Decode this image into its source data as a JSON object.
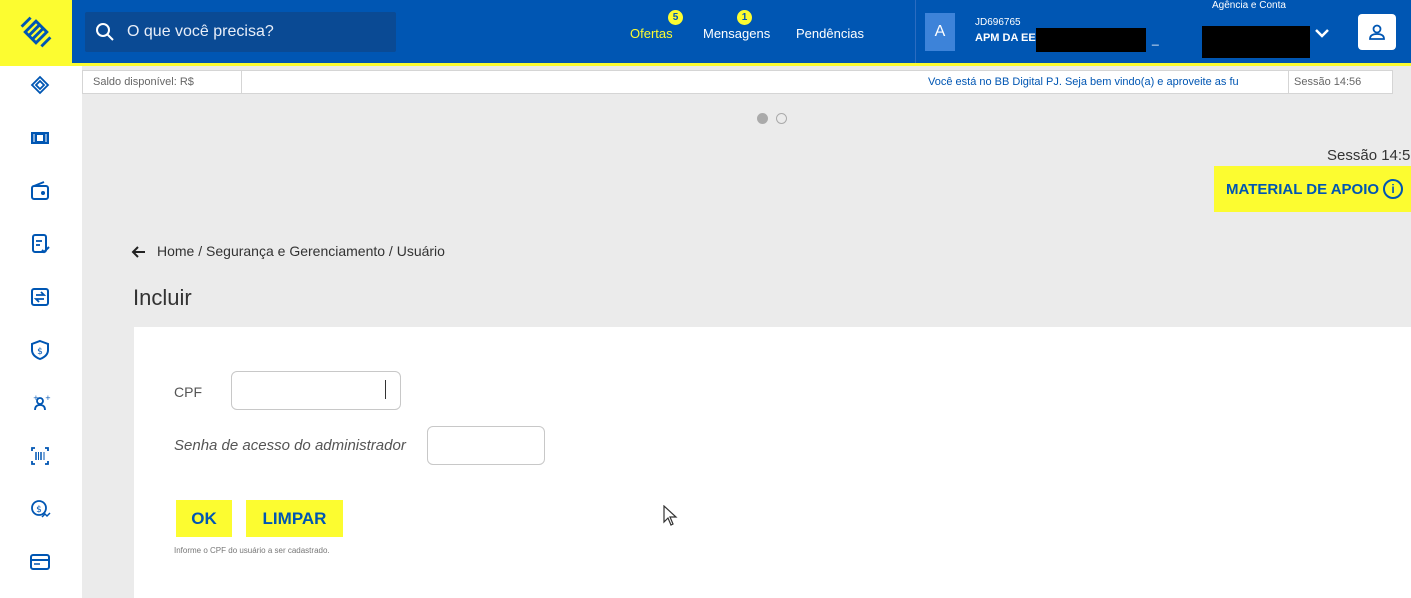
{
  "header": {
    "search_placeholder": "O que você precisa?",
    "nav": {
      "ofertas": "Ofertas",
      "ofertas_badge": "5",
      "mensagens": "Mensagens",
      "mensagens_badge": "1",
      "pendencias": "Pendências"
    },
    "avatar_letter": "A",
    "account_id": "JD696765",
    "account_name": "APM DA EE",
    "account_dash": "_",
    "agencia_label": "Agência e Conta"
  },
  "infobar": {
    "saldo": "Saldo disponível: R$",
    "welcome": "Você está no BB Digital PJ. Seja bem vindo(a) e aproveite as fu",
    "sessao": "Sessão 14:56"
  },
  "sessao_big": "Sessão 14:5",
  "material_apoio": "MATERIAL DE APOIO",
  "breadcrumb": {
    "home": "Home",
    "sep": " / ",
    "seg": "Segurança e Gerenciamento",
    "usuario": "Usuário"
  },
  "page_title": "Incluir",
  "form": {
    "cpf_label": "CPF",
    "senha_label": "Senha de acesso do administrador",
    "ok": "OK",
    "limpar": "LIMPAR",
    "hint": "Informe o CPF do usuário a ser cadastrado."
  },
  "colors": {
    "brand_blue": "#0056b3",
    "brand_yellow": "#fcfc30"
  }
}
